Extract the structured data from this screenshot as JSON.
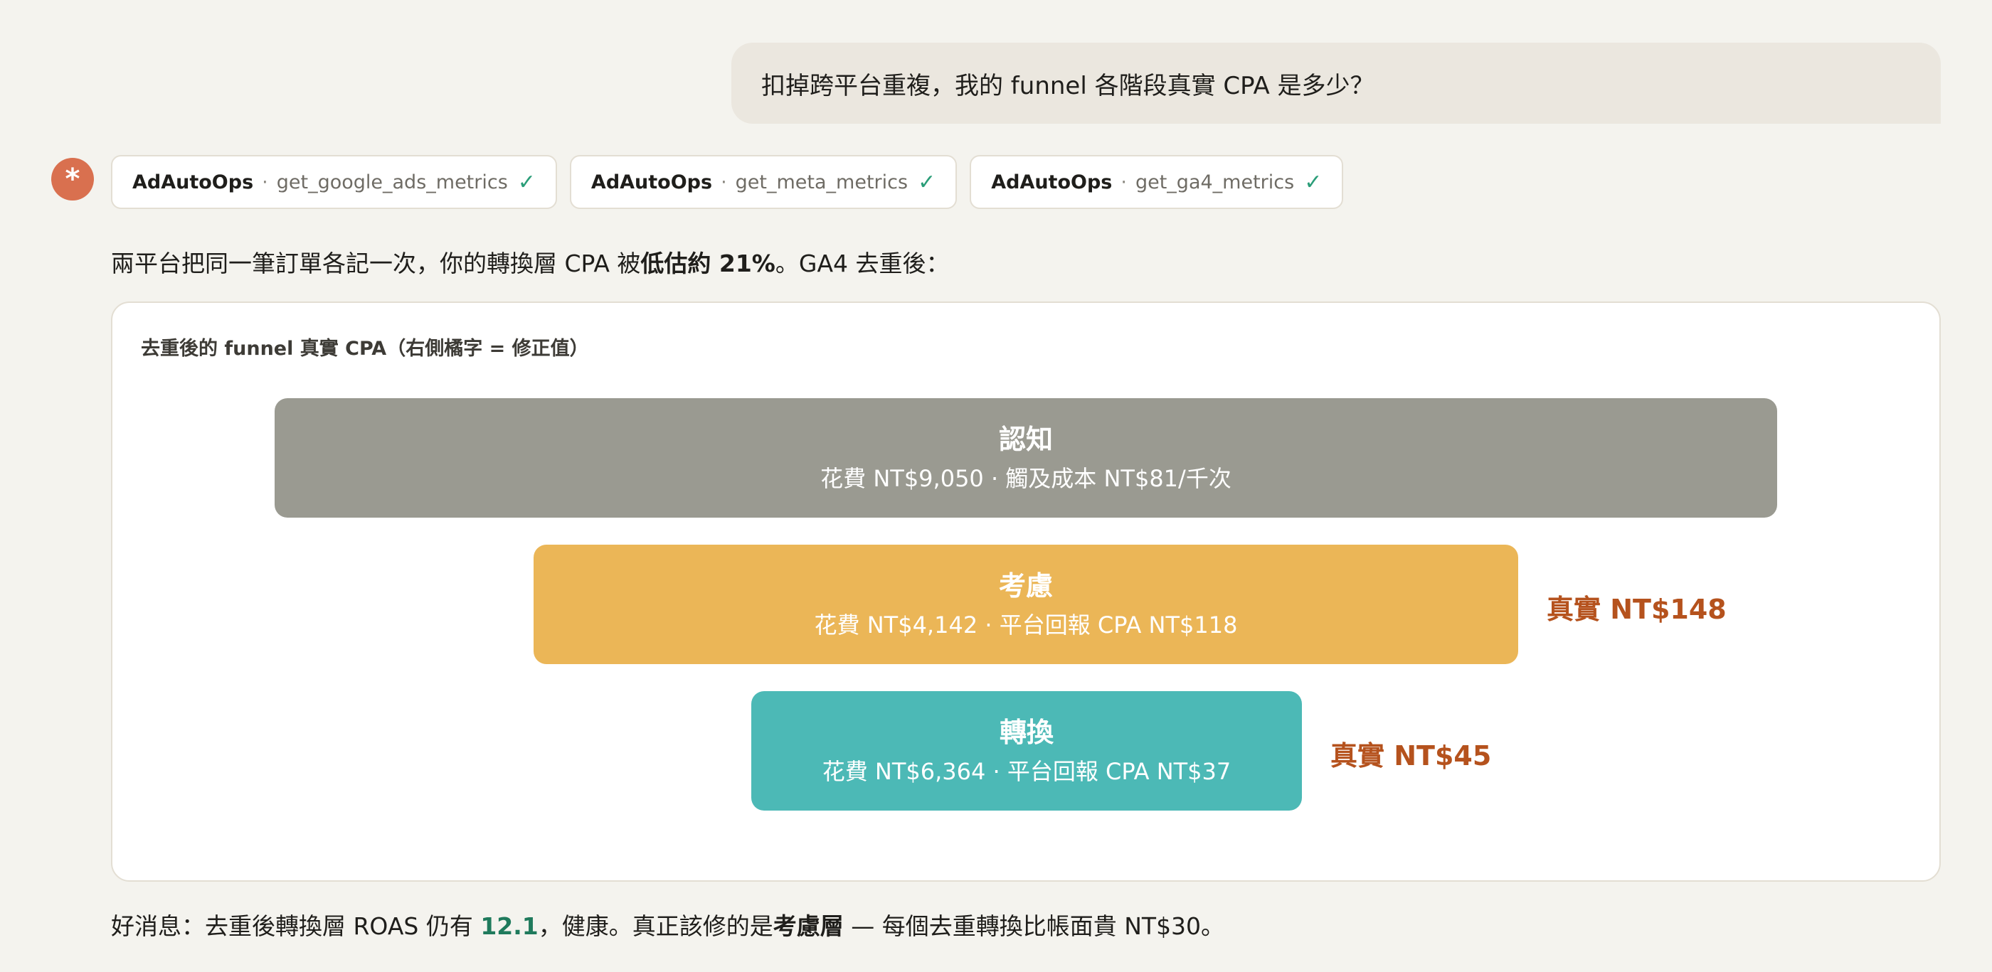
{
  "user_message": "扣掉跨平台重複，我的 funnel 各階段真實 CPA 是多少？",
  "assistant": {
    "avatar_glyph": "*",
    "tool_calls": [
      {
        "app": "AdAutoOps",
        "separator": "·",
        "tool": "get_google_ads_metrics",
        "status": "✓"
      },
      {
        "app": "AdAutoOps",
        "separator": "·",
        "tool": "get_meta_metrics",
        "status": "✓"
      },
      {
        "app": "AdAutoOps",
        "separator": "·",
        "tool": "get_ga4_metrics",
        "status": "✓"
      }
    ],
    "lead": {
      "before": "兩平台把同一筆訂單各記一次，你的轉換層 CPA 被",
      "bold": "低估約 21%",
      "after": "。GA4 去重後："
    },
    "funnel_card": {
      "title": "去重後的 funnel 真實 CPA（右側橘字 = 修正值）",
      "stages": [
        {
          "name": "認知",
          "detail": "花費 NT$9,050 · 觸及成本 NT$81/千次",
          "true_cpa": ""
        },
        {
          "name": "考慮",
          "detail": "花費 NT$4,142 · 平台回報 CPA NT$118",
          "true_cpa": "真實 NT$148"
        },
        {
          "name": "轉換",
          "detail": "花費 NT$6,364 · 平台回報 CPA NT$37",
          "true_cpa": "真實 NT$45"
        }
      ]
    },
    "footer": {
      "part1": "好消息：去重後轉換層 ROAS 仍有 ",
      "roas": "12.1",
      "part2": "，健康。真正該修的是",
      "bold": "考慮層",
      "part3": " — 每個去重轉換比帳面貴 NT$30。"
    }
  },
  "colors": {
    "background": "#f4f3ee",
    "user_bubble": "#ebe7df",
    "avatar": "#d9704f",
    "stage_awareness": "#9a9a91",
    "stage_consideration": "#ebb657",
    "stage_conversion": "#4cb9b6",
    "true_cpa_text": "#b5521d",
    "check_mark": "#2a9d78",
    "roas_highlight": "#1f7a5c"
  }
}
